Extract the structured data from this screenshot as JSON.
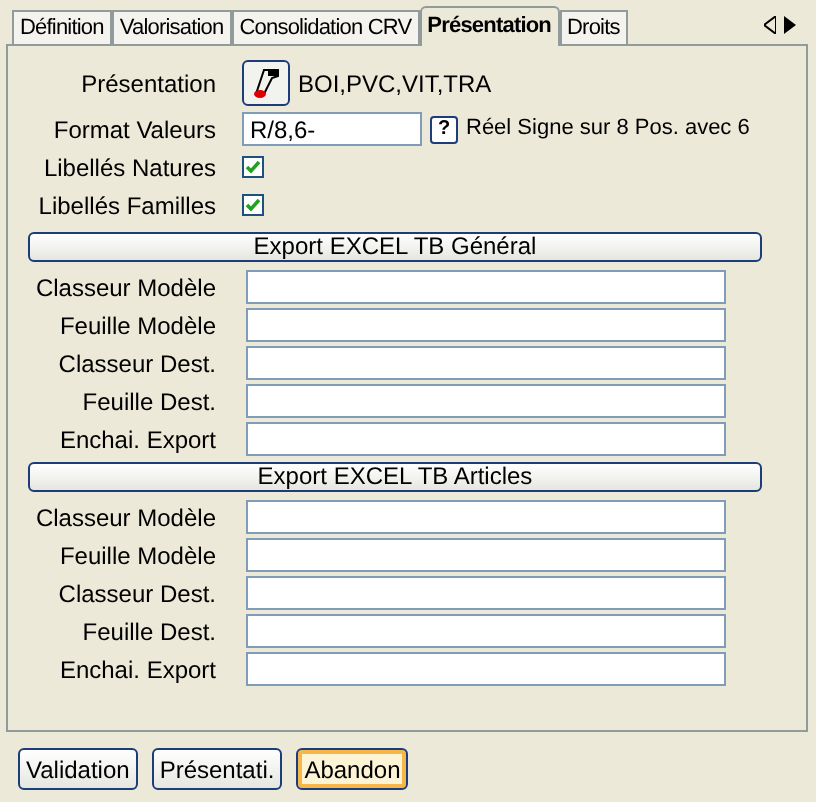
{
  "tabs": [
    {
      "label": "Définition",
      "selected": false
    },
    {
      "label": "Valorisation",
      "selected": false
    },
    {
      "label": "Consolidation CRV",
      "selected": false
    },
    {
      "label": "Présentation",
      "selected": true
    },
    {
      "label": "Droits",
      "selected": false
    }
  ],
  "presentation": {
    "label": "Présentation",
    "value": "BOI,PVC,VIT,TRA"
  },
  "format_valeurs": {
    "label": "Format Valeurs",
    "value": "R/8,6-",
    "help": "?",
    "description": "Réel Signe sur 8 Pos. avec 6"
  },
  "checkboxes": [
    {
      "label": "Libellés Natures",
      "checked": true
    },
    {
      "label": "Libellés Familles",
      "checked": true
    }
  ],
  "sections": [
    {
      "title": "Export EXCEL TB Général",
      "fields": [
        {
          "label": "Classeur Modèle"
        },
        {
          "label": "Feuille Modèle"
        },
        {
          "label": "Classeur Dest."
        },
        {
          "label": "Feuille Dest."
        },
        {
          "label": "Enchai. Export"
        }
      ]
    },
    {
      "title": "Export EXCEL TB Articles",
      "fields": [
        {
          "label": "Classeur Modèle"
        },
        {
          "label": "Feuille Modèle"
        },
        {
          "label": "Classeur Dest."
        },
        {
          "label": "Feuille Dest."
        },
        {
          "label": "Enchai. Export"
        }
      ]
    }
  ],
  "buttons": [
    {
      "label": "Validation",
      "focused": false
    },
    {
      "label": "Présentati.",
      "focused": false
    },
    {
      "label": "Abandon",
      "focused": true
    }
  ]
}
